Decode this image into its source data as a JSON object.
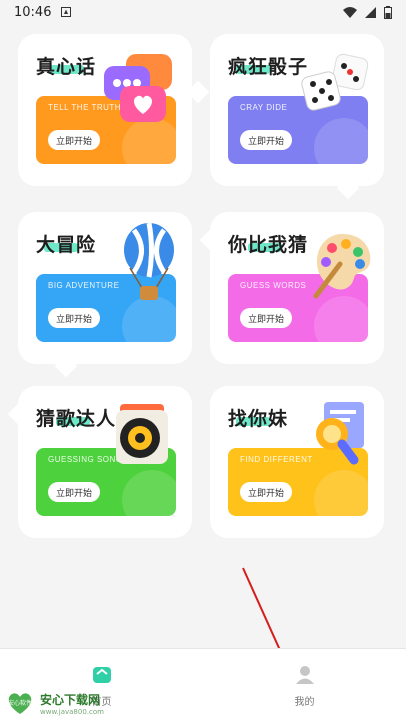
{
  "status_bar": {
    "time": "10:46"
  },
  "cards": [
    {
      "title": "真心话",
      "subtitle": "TELL THE TRUTH",
      "button": "立即开始",
      "color": "#ff9a1f",
      "icon": "chat-heart-icon"
    },
    {
      "title": "疯狂骰子",
      "subtitle": "CRAY DIDE",
      "button": "立即开始",
      "color": "#7f7ff1",
      "icon": "dice-icon"
    },
    {
      "title": "大冒险",
      "subtitle": "BIG ADVENTURE",
      "button": "立即开始",
      "color": "#35a5f5",
      "icon": "hot-air-balloon-icon"
    },
    {
      "title": "你比我猜",
      "subtitle": "GUESS WORDS",
      "button": "立即开始",
      "color": "#f46be8",
      "icon": "paint-palette-icon"
    },
    {
      "title": "猜歌达人",
      "subtitle": "GUESSING SONG",
      "button": "立即开始",
      "color": "#4dd13c",
      "icon": "speaker-icon"
    },
    {
      "title": "找你妹",
      "subtitle": "FIND DIFFERENT",
      "button": "立即开始",
      "color": "#ffc21a",
      "icon": "magnifier-icon"
    }
  ],
  "bottom_nav": {
    "tabs": [
      {
        "label": "首页",
        "icon": "home-icon",
        "active": true
      },
      {
        "label": "我的",
        "icon": "user-icon",
        "active": false
      }
    ]
  },
  "watermark": {
    "text": "安心下载网",
    "url": "www.java800.com",
    "badge": "安心软件"
  }
}
